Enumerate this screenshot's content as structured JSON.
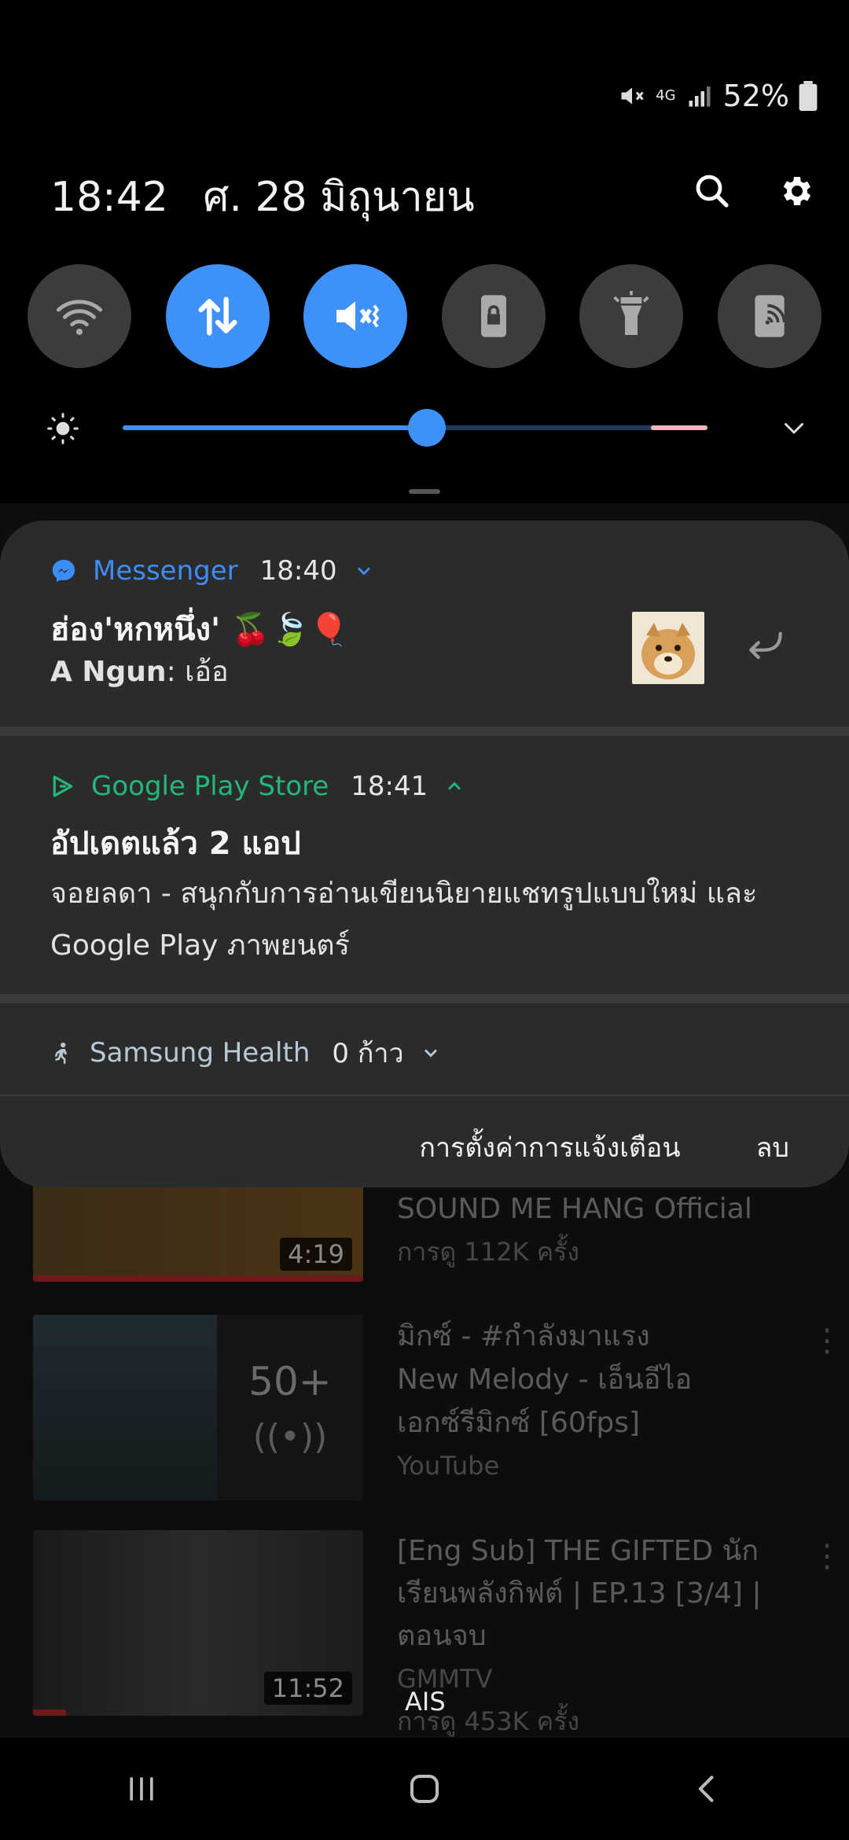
{
  "status_bar": {
    "battery": "52%",
    "network": "4G"
  },
  "header": {
    "time": "18:42",
    "date": "ศ. 28 มิถุนายน"
  },
  "quick_settings": [
    {
      "name": "wifi",
      "on": false
    },
    {
      "name": "mobile-data",
      "on": true
    },
    {
      "name": "sound-vibrate",
      "on": true
    },
    {
      "name": "screen-lock",
      "on": false
    },
    {
      "name": "flashlight",
      "on": false
    },
    {
      "name": "nfc-share",
      "on": false
    }
  ],
  "brightness": {
    "level": 0.52
  },
  "notifications": {
    "messenger": {
      "app": "Messenger",
      "time": "18:40",
      "title": "ฮ่อง'หกหนึ่ง' 🍒🍃🎈",
      "sender": "A Ngun",
      "message": ": เอ้อ"
    },
    "playstore": {
      "app": "Google Play Store",
      "time": "18:41",
      "title": "อัปเดตแล้ว 2 แอป",
      "line1": "จอยลดา - สนุกกับการอ่านเขียนนิยายแชทรูปแบบใหม่ และ",
      "line2": "Google Play ภาพยนตร์"
    },
    "health": {
      "app": "Samsung Health",
      "value": "0 ก้าว"
    },
    "actions": {
      "settings": "การตั้งค่าการแจ้งเตือน",
      "clear": "ลบ"
    }
  },
  "background_feed": {
    "item1": {
      "channel": "SOUND ME HANG Official",
      "views": "การดู 112K ครั้ง",
      "duration": "4:19"
    },
    "item2": {
      "line1": "มิกซ์ - #กำลังมาแรง",
      "line2": "New Melody - เอ็นอีไอ",
      "line3": "เอกซ์รีมิกซ์ [60fps]",
      "channel": "YouTube",
      "count": "50+"
    },
    "item3": {
      "line1": "[Eng Sub] THE GIFTED นัก",
      "line2": "เรียนพลังกิฟต์ | EP.13 [3/4] |",
      "line3": "ตอนจบ",
      "channel": "GMMTV",
      "views": "การดู 453K ครั้ง",
      "duration": "11:52"
    }
  },
  "carrier": "AIS",
  "colors": {
    "accent": "#3e91f7",
    "messenger": "#3d8df6",
    "playstore": "#24b77a",
    "card": "#2b2b2b"
  }
}
